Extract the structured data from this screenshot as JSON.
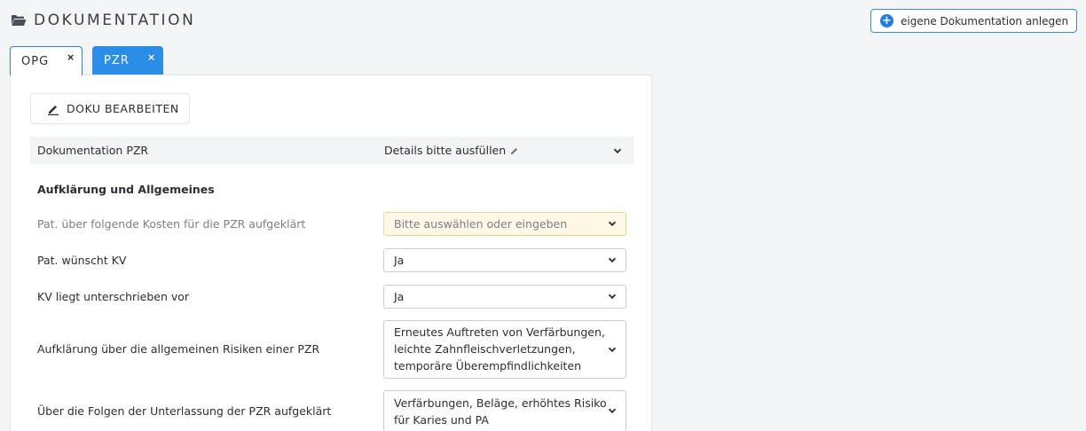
{
  "header": {
    "title": "DOKUMENTATION",
    "add_button_label": "eigene Dokumentation anlegen"
  },
  "tabs": [
    {
      "label": "OPG",
      "close": "×",
      "active": false
    },
    {
      "label": "PZR",
      "close": "×",
      "active": true
    }
  ],
  "panel": {
    "edit_button_label": "DOKU BEARBEITEN",
    "summary": {
      "label": "Dokumentation PZR",
      "value": "Details bitte ausfüllen"
    },
    "section_title": "Aufklärung und Allgemeines",
    "fields": [
      {
        "label": "Pat. über folgende Kosten für die PZR aufgeklärt",
        "value": "Bitte auswählen oder eingeben",
        "placeholder": true
      },
      {
        "label": "Pat. wünscht KV",
        "value": "Ja"
      },
      {
        "label": "KV liegt unterschrieben vor",
        "value": "Ja"
      },
      {
        "label": "Aufklärung über die allgemeinen Risiken einer PZR",
        "value_lines": [
          "Erneutes Auftreten von Verfärbungen,",
          "leichte Zahnfleischverletzungen,",
          "temporäre Überempfindlichkeiten"
        ]
      },
      {
        "label": "Über die Folgen der Unterlassung der PZR aufgeklärt",
        "value_lines": [
          "Verfärbungen, Beläge, erhöhtes Risiko",
          "für Karies und PA"
        ]
      }
    ]
  },
  "colors": {
    "accent": "#2a8ee8",
    "warning_bg": "#fff8e6",
    "warning_border": "#f1d58b"
  },
  "icons": [
    "folder-open-icon",
    "plus-circle-icon",
    "close-icon",
    "pencil-icon",
    "chevron-down-icon"
  ]
}
